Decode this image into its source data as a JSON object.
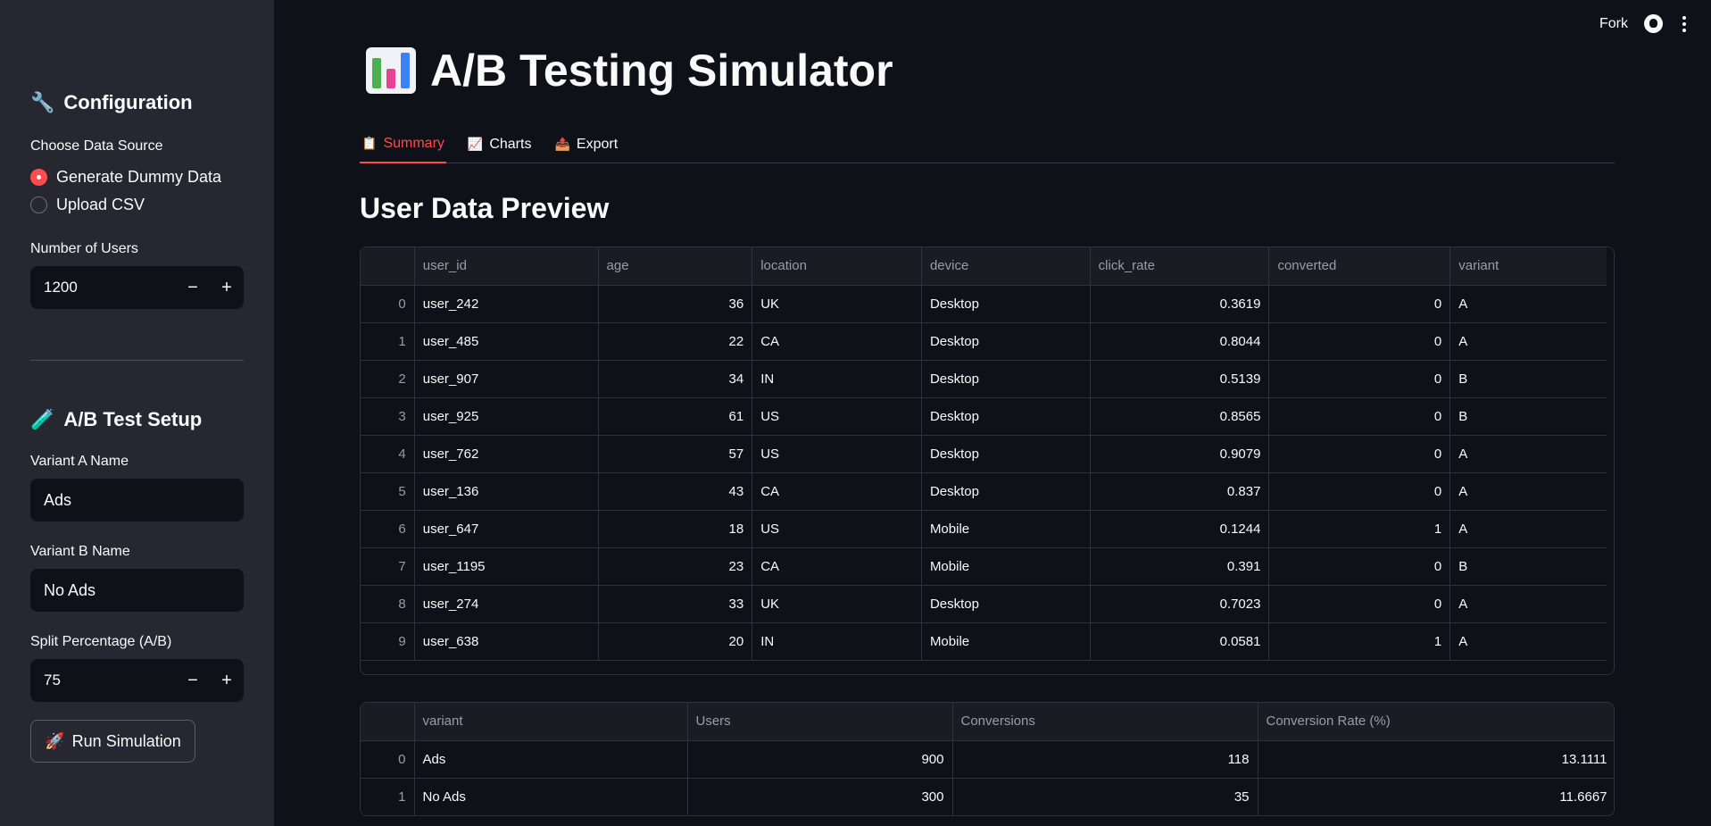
{
  "topbar": {
    "fork_label": "Fork"
  },
  "sidebar": {
    "config_heading": "Configuration",
    "config_icon": "🔧",
    "data_source_label": "Choose Data Source",
    "data_source_options": [
      "Generate Dummy Data",
      "Upload CSV"
    ],
    "data_source_selected": "Generate Dummy Data",
    "num_users_label": "Number of Users",
    "num_users_value": "1200",
    "ab_heading": "A/B Test Setup",
    "ab_icon": "🧪",
    "variant_a_label": "Variant A Name",
    "variant_a_value": "Ads",
    "variant_b_label": "Variant B Name",
    "variant_b_value": "No Ads",
    "split_label": "Split Percentage (A/B)",
    "split_value": "75",
    "run_label": "Run Simulation",
    "run_icon": "🚀"
  },
  "main": {
    "title": "A/B Testing Simulator",
    "tabs": [
      {
        "icon": "📋",
        "label": "Summary",
        "active": true
      },
      {
        "icon": "📈",
        "label": "Charts",
        "active": false
      },
      {
        "icon": "📤",
        "label": "Export",
        "active": false
      }
    ],
    "preview_title": "User Data Preview",
    "preview_columns": [
      "",
      "user_id",
      "age",
      "location",
      "device",
      "click_rate",
      "converted",
      "variant"
    ],
    "preview_rows": [
      [
        "0",
        "user_242",
        "36",
        "UK",
        "Desktop",
        "0.3619",
        "0",
        "A"
      ],
      [
        "1",
        "user_485",
        "22",
        "CA",
        "Desktop",
        "0.8044",
        "0",
        "A"
      ],
      [
        "2",
        "user_907",
        "34",
        "IN",
        "Desktop",
        "0.5139",
        "0",
        "B"
      ],
      [
        "3",
        "user_925",
        "61",
        "US",
        "Desktop",
        "0.8565",
        "0",
        "B"
      ],
      [
        "4",
        "user_762",
        "57",
        "US",
        "Desktop",
        "0.9079",
        "0",
        "A"
      ],
      [
        "5",
        "user_136",
        "43",
        "CA",
        "Desktop",
        "0.837",
        "0",
        "A"
      ],
      [
        "6",
        "user_647",
        "18",
        "US",
        "Mobile",
        "0.1244",
        "1",
        "A"
      ],
      [
        "7",
        "user_1195",
        "23",
        "CA",
        "Mobile",
        "0.391",
        "0",
        "B"
      ],
      [
        "8",
        "user_274",
        "33",
        "UK",
        "Desktop",
        "0.7023",
        "0",
        "A"
      ],
      [
        "9",
        "user_638",
        "20",
        "IN",
        "Mobile",
        "0.0581",
        "1",
        "A"
      ]
    ],
    "summary_columns": [
      "",
      "variant",
      "Users",
      "Conversions",
      "Conversion Rate (%)"
    ],
    "summary_rows": [
      [
        "0",
        "Ads",
        "900",
        "118",
        "13.1111"
      ],
      [
        "1",
        "No Ads",
        "300",
        "35",
        "11.6667"
      ]
    ]
  },
  "colors": {
    "accent": "#ff4b4b",
    "background": "#0e1117",
    "sidebar": "#262730"
  }
}
